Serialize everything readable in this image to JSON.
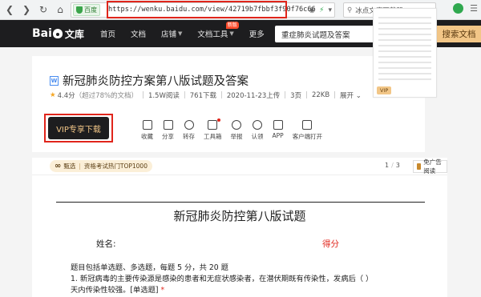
{
  "browser": {
    "site_badge": "百度",
    "url": "https://wenku.baidu.com/view/42719b7fbbf3f90f76c66",
    "search_placeholder": "冰点文库下载器",
    "icons": [
      "back-icon",
      "forward-icon",
      "refresh-icon",
      "home-icon",
      "star-icon",
      "lightning-icon",
      "search-icon",
      "extension-icon",
      "menu-icon"
    ]
  },
  "header": {
    "logo_text": "Bai",
    "logo_suffix": "文库",
    "nav": [
      {
        "label": "首页"
      },
      {
        "label": "文档"
      },
      {
        "label": "店铺",
        "has_caret": true
      },
      {
        "label": "文档工具",
        "has_caret": true,
        "badge": "新版"
      },
      {
        "label": "更多"
      }
    ],
    "search_value": "重症肺炎试题及答案",
    "search_button": "搜索文档"
  },
  "doc": {
    "type_icon": "W",
    "title": "新冠肺炎防控方案第八版试题及答案",
    "rating": "4.4分",
    "rating_note": "（超过78%的文档）",
    "reads": "1.5W阅读",
    "downloads": "761下载",
    "date": "2020-11-23上传",
    "pages": "3页",
    "size": "22KB",
    "expand": "展开",
    "vip_button": "VIP专享下载",
    "actions": [
      {
        "label": "收藏",
        "icon": "star-icon"
      },
      {
        "label": "分享",
        "icon": "share-icon"
      },
      {
        "label": "转存",
        "icon": "save-icon"
      },
      {
        "label": "工具箱",
        "icon": "toolbox-icon"
      },
      {
        "label": "举报",
        "icon": "report-icon"
      },
      {
        "label": "认领",
        "icon": "claim-icon"
      },
      {
        "label": "APP",
        "icon": "phone-icon"
      },
      {
        "label": "客户端打开",
        "icon": "desktop-icon"
      }
    ],
    "thumb_tag": "VIP"
  },
  "reader": {
    "rec_label": "甄选",
    "rec_text": "资格考试热门TOP1000",
    "page_current": "1",
    "page_total": "3",
    "ad_free": "免广告阅读"
  },
  "content": {
    "heading": "新冠肺炎防控第八版试题",
    "name_label": "姓名:",
    "score_label": "得分",
    "intro": "题目包括单选题、多选题，每题 5 分，共 20 题",
    "q1_line1": "1. 新冠病毒的主要传染源是感染的患者和无症状感染者，在潜伏期既有传染性，发病后（    ）",
    "q1_line2": "天内传染性较强。[单选题]",
    "required_mark": "*"
  }
}
